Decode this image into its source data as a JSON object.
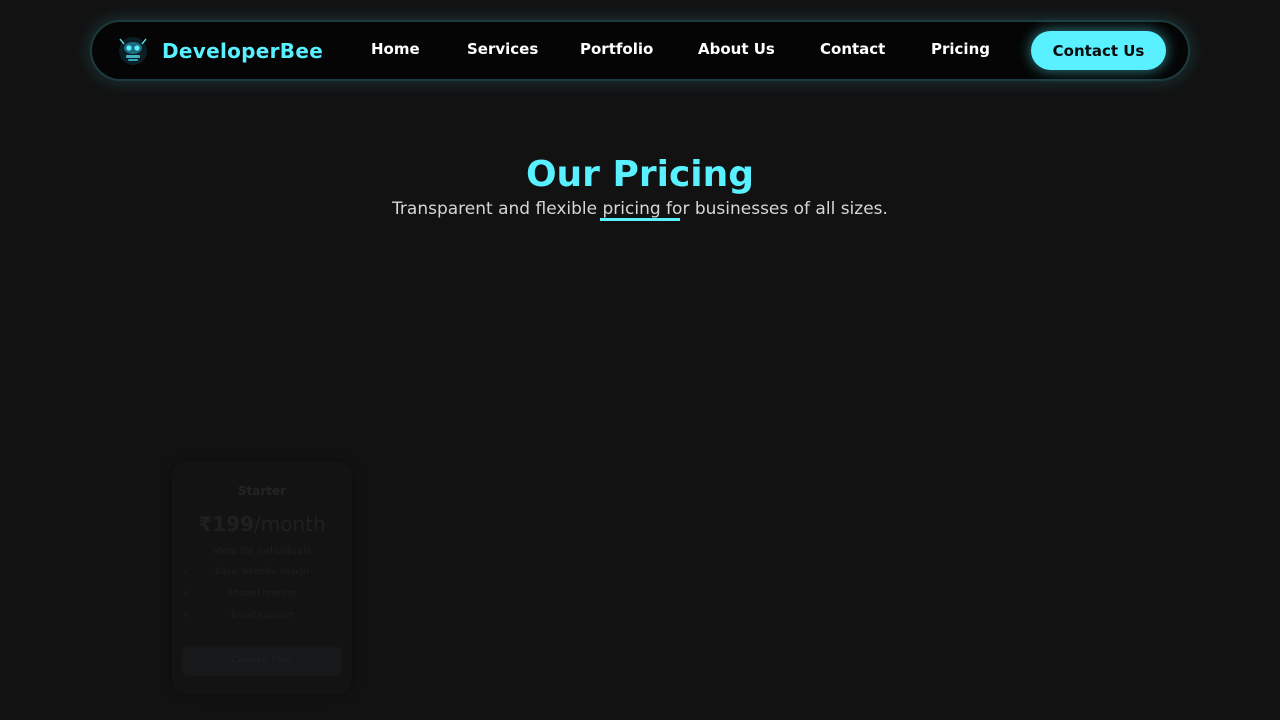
{
  "brand": {
    "name": "DeveloperBee",
    "logo_icon": "bee-mascot-icon"
  },
  "nav": {
    "links": [
      "Home",
      "Services",
      "Portfolio",
      "About Us",
      "Contact",
      "Pricing"
    ],
    "cta_label": "Contact Us"
  },
  "hero": {
    "title": "Our Pricing",
    "subtitle": "Transparent and flexible pricing for businesses of all sizes."
  },
  "pricing": {
    "cards": [
      {
        "name": "Starter",
        "price": "₹199",
        "period": "/month",
        "description": "Ideal for individuals",
        "features": [
          "Basic website design",
          "Shared hosting",
          "Email support"
        ],
        "button_label": "Choose Plan"
      }
    ]
  },
  "colors": {
    "accent": "#59f0ff",
    "background": "#121212",
    "navbar_background": "#050505"
  }
}
